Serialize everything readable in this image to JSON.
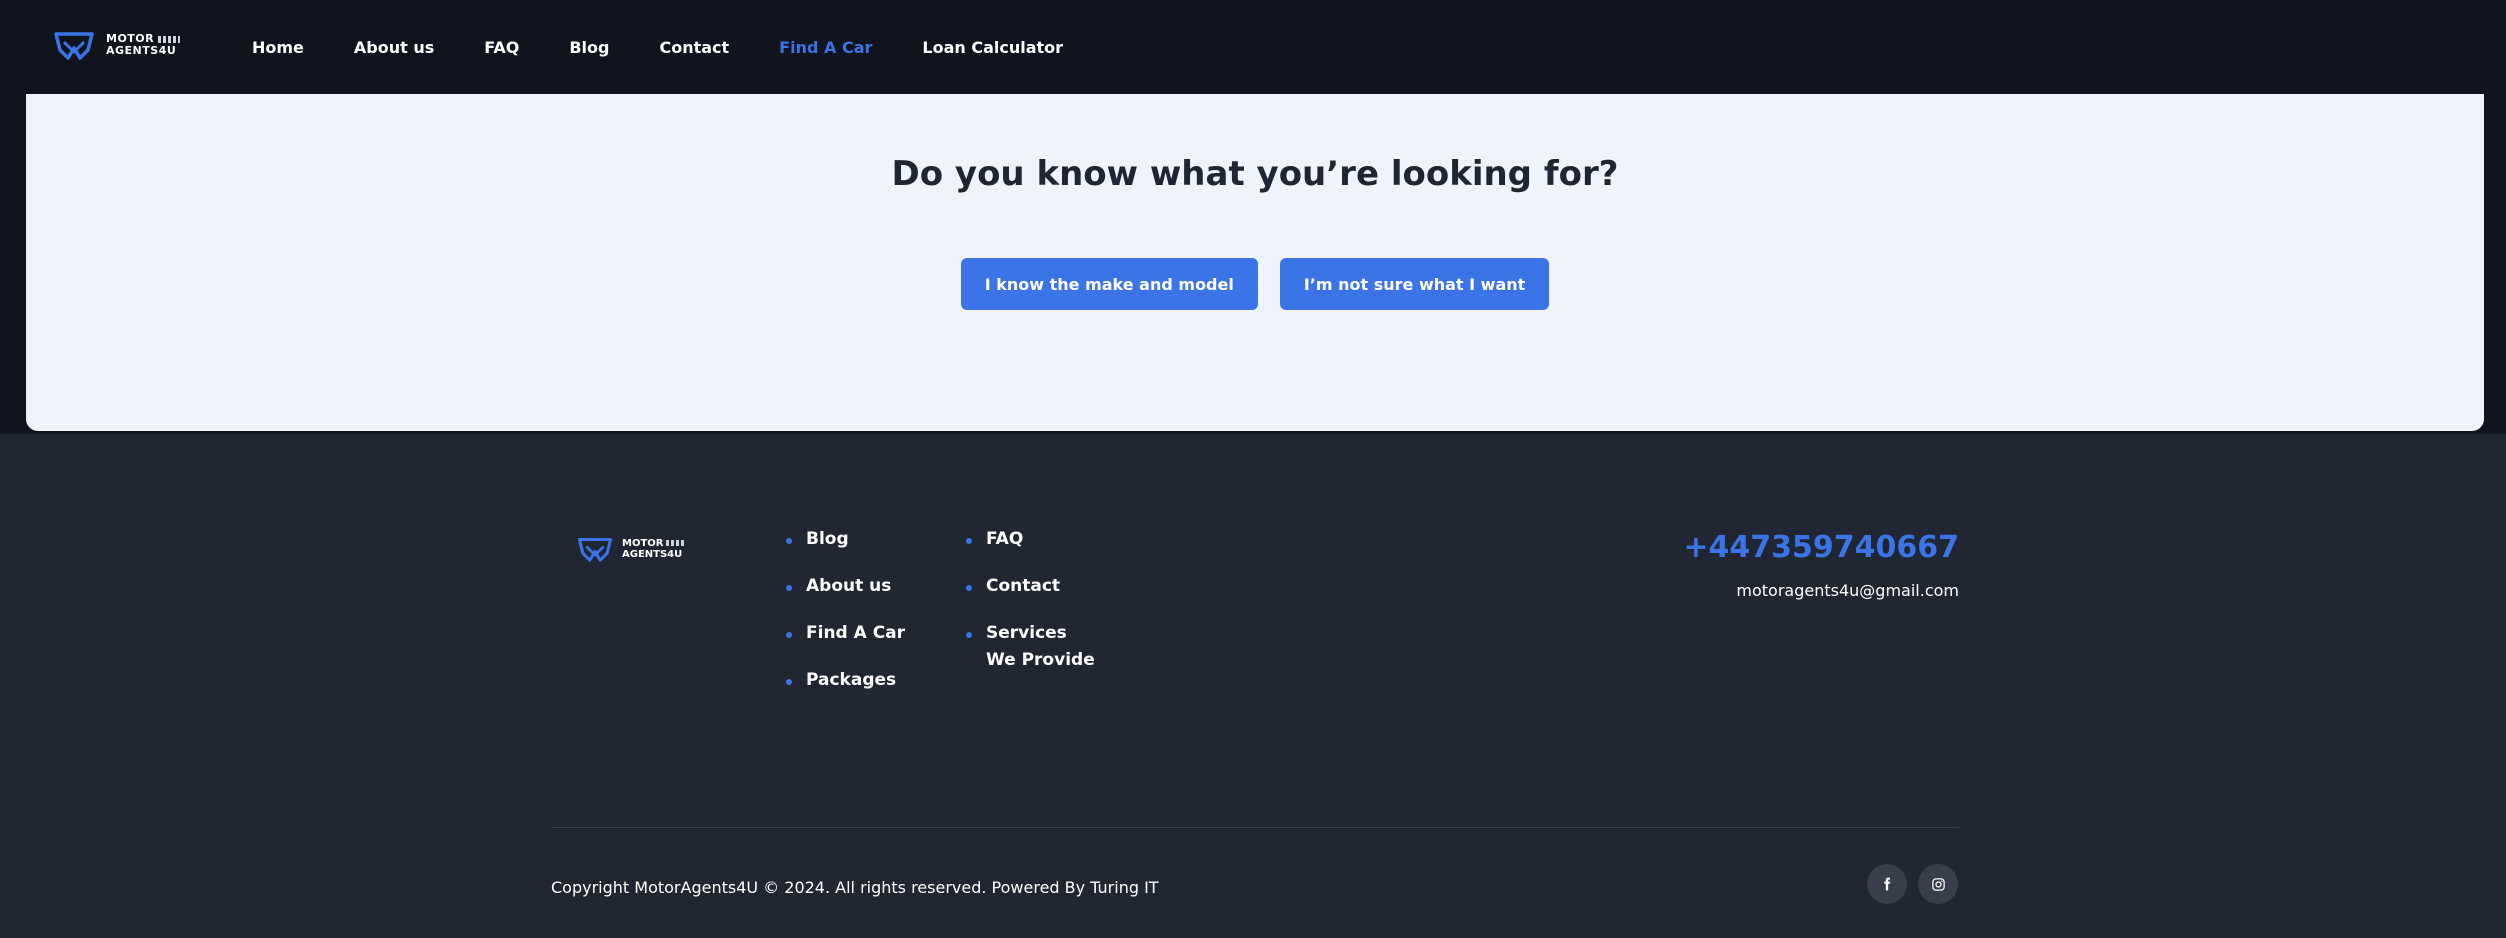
{
  "header": {
    "logo": {
      "line1": "MOTOR",
      "line2": "AGENTS4U"
    },
    "nav": [
      {
        "label": "Home"
      },
      {
        "label": "About us"
      },
      {
        "label": "FAQ"
      },
      {
        "label": "Blog"
      },
      {
        "label": "Contact"
      },
      {
        "label": "Find A Car",
        "active": true
      },
      {
        "label": "Loan Calculator"
      }
    ]
  },
  "hero": {
    "title": "Do you know what you’re looking for?",
    "buttons": {
      "know": "I know the make and model",
      "unsure": "I’m not sure what I want"
    }
  },
  "footer": {
    "logo": {
      "line1": "MOTOR",
      "line2": "AGENTS4U"
    },
    "links_col1": [
      "Blog",
      "About us",
      "Find A Car",
      "Packages"
    ],
    "links_col2": [
      "FAQ",
      "Contact",
      "Services We Provide"
    ],
    "phone": "+447359740667",
    "email": "motoragents4u@gmail.com",
    "copyright": "Copyright MotorAgents4U © 2024. All rights reserved. Powered By Turing IT",
    "social": [
      "facebook-icon",
      "instagram-icon"
    ]
  },
  "colors": {
    "accent": "#3b74e6",
    "header_bg": "#0f141f",
    "hero_bg": "#eff3fb",
    "footer_bg": "#212633",
    "heading": "#1e2533"
  }
}
